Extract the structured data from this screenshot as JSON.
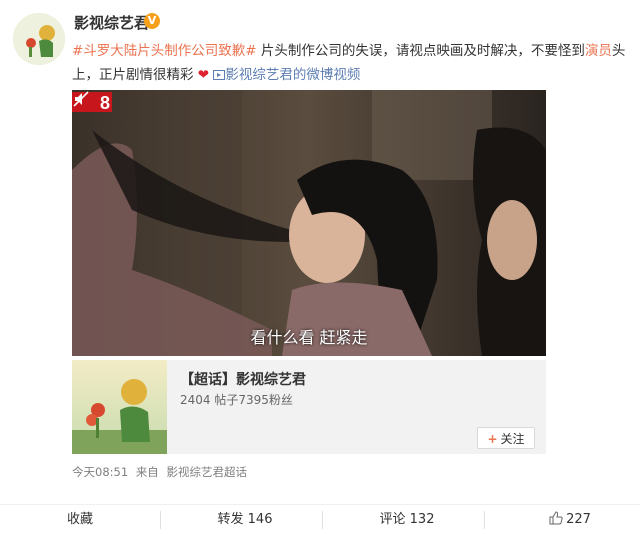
{
  "post": {
    "username": "影视综艺君",
    "verified_badge": "V",
    "hashtag1": "#斗罗大陆片头制作公司致歉#",
    "text1": " 片头制作公司的失误，请视点映画及时解决，不要怪到",
    "highlight_word": "演员",
    "text2": "头上，正片剧情很精彩",
    "video_link_icon": "video-link-icon",
    "video_link": "影视综艺君的微博视频",
    "video_caption": "看什么看  赶紧走",
    "accent_colors": {
      "link": "#eb7350",
      "blue": "#5d7db3",
      "badge": "#f7a11b"
    }
  },
  "card": {
    "title": "【超话】影视综艺君",
    "subtitle": "2404 帖子7395粉丝",
    "follow_label": "关注"
  },
  "meta": {
    "time": "今天08:51",
    "source_prefix": "来自",
    "source": "影视综艺君超话"
  },
  "actions": {
    "favorite": "收藏",
    "repost": "转发 146",
    "comment": "评论 132",
    "like": "227"
  }
}
